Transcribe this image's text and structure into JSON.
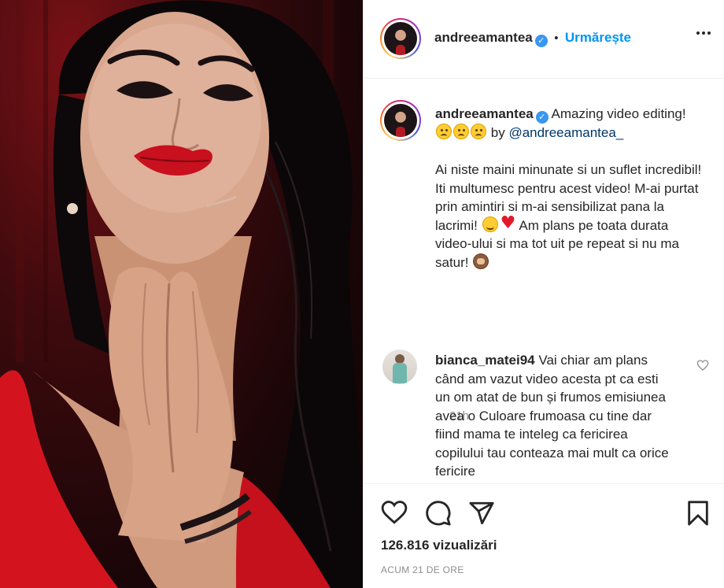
{
  "post": {
    "username": "andreeamantea",
    "follow_label": "Urmărește",
    "separator": "•",
    "verified_mark": "✓"
  },
  "caption": {
    "username": "andreeamantea",
    "line_1": "Amazing video editing!",
    "line_1_emojis": [
      "sad-face-emoji",
      "sad-face-emoji",
      "sad-face-emoji"
    ],
    "by_label": "by",
    "mention": "@andreeamantea_",
    "body_part_1": "Ai niste maini minunate si un suflet incredibil! Iti multumesc pentru acest video! M-ai purtat prin amintiri si m-ai sensibilizat pana la lacrimi!",
    "body_emojis_1": [
      "hugging-face-emoji",
      "red-heart-emoji"
    ],
    "body_part_2": "Am plans pe toata durata video-ului si ma tot uit pe repeat si nu ma satur!",
    "body_emojis_2": [
      "see-no-evil-monkey-emoji"
    ],
    "time": "21h"
  },
  "comment": {
    "username": "bianca_matei94",
    "text": "Vai chiar am plans când am vazut video acesta pt ca esti un om atat de bun și frumos emisiunea avea o Culoare frumoasa cu tine dar fiind mama te inteleg ca fericirea copilului tau conteaza mai mult ca orice fericire"
  },
  "actions": {
    "icons": [
      "heart-icon",
      "comment-icon",
      "share-icon",
      "bookmark-icon"
    ],
    "views": "126.816 vizualizări",
    "posted": "ACUM 21 DE ORE"
  },
  "colors": {
    "accent": "#0095f6",
    "text": "#262626",
    "muted": "#8e8e8e",
    "verified": "#3897f0",
    "border": "#efefef"
  }
}
